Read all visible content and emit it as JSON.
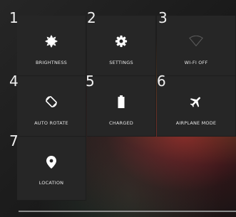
{
  "tiles": [
    {
      "number": "1",
      "label": "BRIGHTNESS",
      "icon": "brightness-icon"
    },
    {
      "number": "2",
      "label": "SETTINGS",
      "icon": "settings-gear-icon"
    },
    {
      "number": "3",
      "label": "WI-FI OFF",
      "icon": "wifi-off-icon"
    },
    {
      "number": "4",
      "label": "AUTO ROTATE",
      "icon": "auto-rotate-icon"
    },
    {
      "number": "5",
      "label": "CHARGED",
      "icon": "battery-icon"
    },
    {
      "number": "6",
      "label": "AIRPLANE MODE",
      "icon": "airplane-icon"
    },
    {
      "number": "7",
      "label": "LOCATION",
      "icon": "location-pin-icon"
    }
  ]
}
